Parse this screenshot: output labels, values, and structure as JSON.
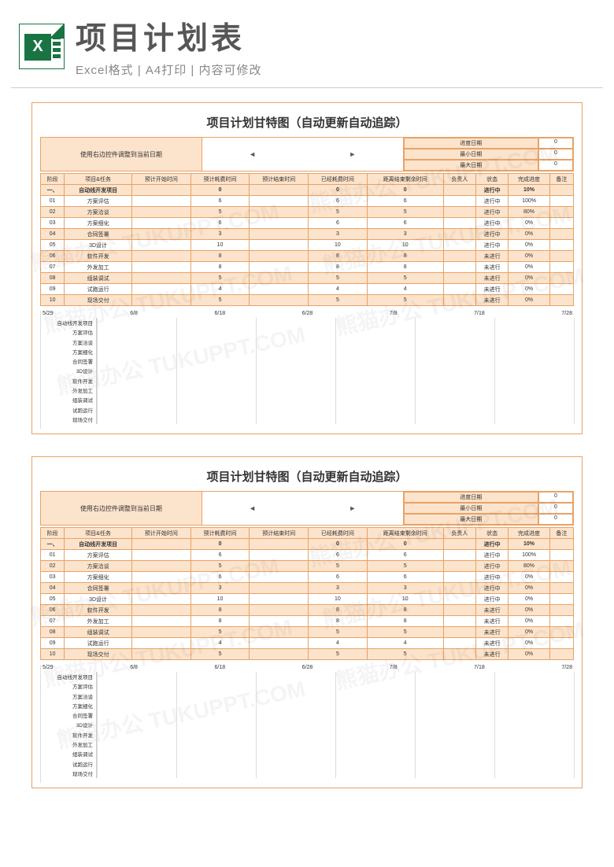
{
  "header": {
    "title": "项目计划表",
    "subtitle": "Excel格式 | A4打印 | 内容可修改",
    "icon_letter": "X"
  },
  "sheet": {
    "title": "项目计划甘特图（自动更新自动追踪）",
    "controls_label": "使用右边控件调整到当前日期",
    "meta": [
      {
        "k": "进度日期",
        "v": "0"
      },
      {
        "k": "最小日期",
        "v": "0"
      },
      {
        "k": "最大日期",
        "v": "0"
      }
    ],
    "columns": [
      "阶段",
      "项目&任务",
      "预计开始时间",
      "预计耗费时间",
      "预计结束时间",
      "已经耗费时间",
      "距离结束剩余时间",
      "负责人",
      "状态",
      "完成进度",
      "备注"
    ],
    "section": {
      "phase": "一、",
      "task": "自动线开发项目",
      "c3": "",
      "c4": "0",
      "c5": "",
      "c6": "0",
      "c7": "0",
      "c8": "",
      "status": "进行中",
      "progress": "10%",
      "note": ""
    },
    "rows": [
      {
        "phase": "01",
        "task": "方案评估",
        "c3": "",
        "c4": "6",
        "c5": "",
        "c6": "6",
        "c7": "6",
        "c8": "",
        "status": "进行中",
        "progress": "100%",
        "note": ""
      },
      {
        "phase": "02",
        "task": "方案洽谈",
        "c3": "",
        "c4": "5",
        "c5": "",
        "c6": "5",
        "c7": "5",
        "c8": "",
        "status": "进行中",
        "progress": "80%",
        "note": ""
      },
      {
        "phase": "03",
        "task": "方案细化",
        "c3": "",
        "c4": "6",
        "c5": "",
        "c6": "6",
        "c7": "6",
        "c8": "",
        "status": "进行中",
        "progress": "0%",
        "note": ""
      },
      {
        "phase": "04",
        "task": "合同签署",
        "c3": "",
        "c4": "3",
        "c5": "",
        "c6": "3",
        "c7": "3",
        "c8": "",
        "status": "进行中",
        "progress": "0%",
        "note": ""
      },
      {
        "phase": "05",
        "task": "3D设计",
        "c3": "",
        "c4": "10",
        "c5": "",
        "c6": "10",
        "c7": "10",
        "c8": "",
        "status": "进行中",
        "progress": "0%",
        "note": ""
      },
      {
        "phase": "06",
        "task": "软件开发",
        "c3": "",
        "c4": "8",
        "c5": "",
        "c6": "8",
        "c7": "8",
        "c8": "",
        "status": "未进行",
        "progress": "0%",
        "note": ""
      },
      {
        "phase": "07",
        "task": "外发加工",
        "c3": "",
        "c4": "8",
        "c5": "",
        "c6": "8",
        "c7": "8",
        "c8": "",
        "status": "未进行",
        "progress": "0%",
        "note": ""
      },
      {
        "phase": "08",
        "task": "组装调试",
        "c3": "",
        "c4": "5",
        "c5": "",
        "c6": "5",
        "c7": "5",
        "c8": "",
        "status": "未进行",
        "progress": "0%",
        "note": ""
      },
      {
        "phase": "09",
        "task": "试跑运行",
        "c3": "",
        "c4": "4",
        "c5": "",
        "c6": "4",
        "c7": "4",
        "c8": "",
        "status": "未进行",
        "progress": "0%",
        "note": ""
      },
      {
        "phase": "10",
        "task": "现场交付",
        "c3": "",
        "c4": "5",
        "c5": "",
        "c6": "5",
        "c7": "5",
        "c8": "",
        "status": "未进行",
        "progress": "0%",
        "note": ""
      }
    ],
    "gantt_dates": [
      "5/29",
      "6/8",
      "6/18",
      "6/28",
      "7/8",
      "7/18",
      "7/28"
    ],
    "gantt_labels": [
      "自动线开发项目",
      "方案评估",
      "方案洽谈",
      "方案细化",
      "合同签署",
      "3D设计",
      "软件开发",
      "外发加工",
      "组装调试",
      "试跑运行",
      "现场交付"
    ]
  },
  "chart_data": {
    "type": "bar",
    "title": "项目计划甘特图",
    "categories": [
      "自动线开发项目",
      "方案评估",
      "方案洽谈",
      "方案细化",
      "合同签署",
      "3D设计",
      "软件开发",
      "外发加工",
      "组装调试",
      "试跑运行",
      "现场交付"
    ],
    "x_dates": [
      "5/29",
      "6/8",
      "6/18",
      "6/28",
      "7/8",
      "7/18",
      "7/28"
    ],
    "series": [
      {
        "name": "预计耗费时间",
        "values": [
          0,
          6,
          5,
          6,
          3,
          10,
          8,
          8,
          5,
          4,
          5
        ]
      },
      {
        "name": "完成进度",
        "values": [
          10,
          100,
          80,
          0,
          0,
          0,
          0,
          0,
          0,
          0,
          0
        ]
      }
    ]
  }
}
